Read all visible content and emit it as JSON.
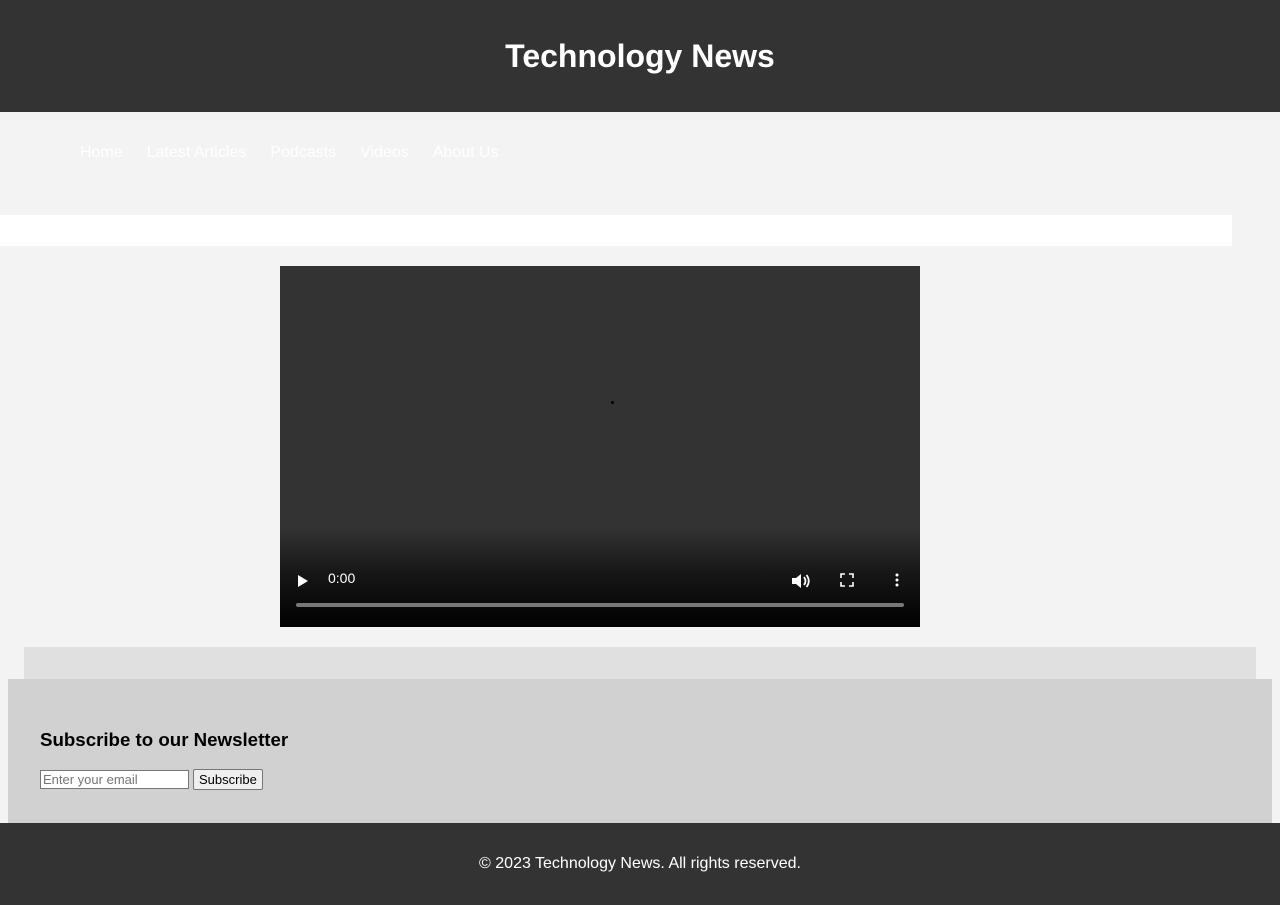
{
  "header": {
    "title": "Technology News"
  },
  "nav": {
    "items": [
      {
        "label": "Home"
      },
      {
        "label": "Latest Articles"
      },
      {
        "label": "Podcasts"
      },
      {
        "label": "Videos"
      },
      {
        "label": "About Us"
      }
    ]
  },
  "video": {
    "current_time": "0:00",
    "progress": 0,
    "icons": {
      "play": "play-icon",
      "volume": "volume-icon",
      "fullscreen": "fullscreen-icon",
      "menu": "more-options-icon"
    }
  },
  "newsletter": {
    "heading": "Subscribe to our Newsletter",
    "email_placeholder": "Enter your email",
    "email_value": "",
    "subscribe_label": "Subscribe"
  },
  "footer": {
    "copyright": "© 2023 Technology News. All rights reserved."
  },
  "colors": {
    "header_bg": "#333333",
    "page_bg": "#f3f3f3",
    "newsletter_bg": "#d1d1d1",
    "panel_bg": "#e0e0e0",
    "nav_text": "#ffffff"
  }
}
